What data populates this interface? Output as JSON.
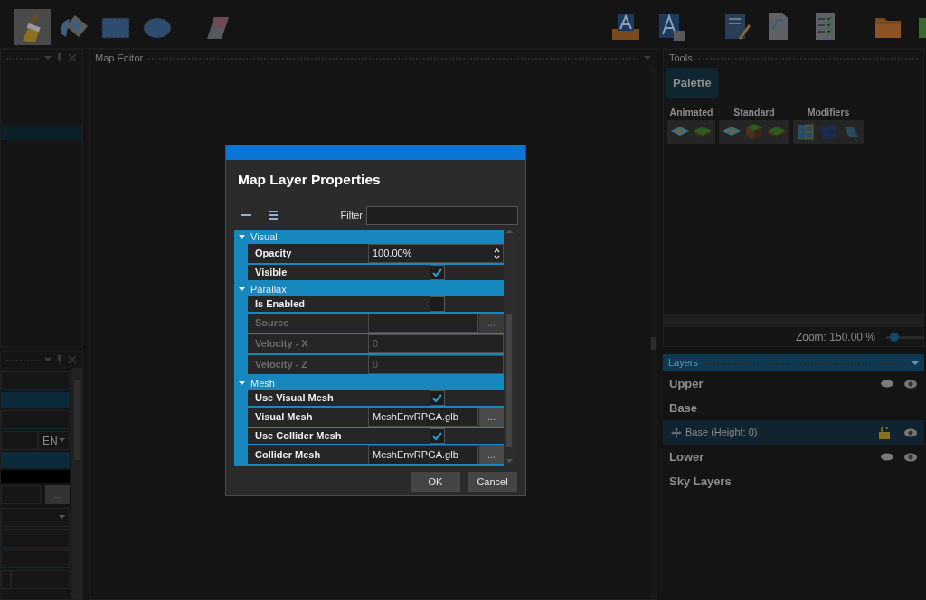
{
  "toolbar": {
    "tools": [
      {
        "kind": "brush",
        "selected": true
      },
      {
        "kind": "fill",
        "selected": false
      },
      {
        "kind": "rect",
        "selected": false
      },
      {
        "kind": "ellipse",
        "selected": false
      },
      {
        "kind": "eraser",
        "selected": false
      }
    ],
    "actions": [
      {
        "kind": "open"
      },
      {
        "kind": "save"
      },
      {
        "kind": "notes"
      },
      {
        "kind": "formula"
      },
      {
        "kind": "checklist"
      },
      {
        "kind": "folder"
      },
      {
        "kind": "run"
      }
    ]
  },
  "left_panel": {
    "rows": [
      {
        "kind": "field"
      },
      {
        "kind": "band"
      },
      {
        "kind": "field"
      },
      {
        "kind": "lang",
        "value": "EN"
      },
      {
        "kind": "band"
      },
      {
        "kind": "black"
      },
      {
        "kind": "browse",
        "button": "..."
      },
      {
        "kind": "select"
      },
      {
        "kind": "field"
      },
      {
        "kind": "field"
      },
      {
        "kind": "split"
      }
    ]
  },
  "map_editor": {
    "title": "Map Editor"
  },
  "tools_panel": {
    "title": "Tools",
    "tab": "Palette",
    "groups": [
      {
        "label": "Animated",
        "tiles": [
          {
            "kind": "water"
          },
          {
            "kind": "grass"
          }
        ]
      },
      {
        "label": "Standard",
        "tiles": [
          {
            "kind": "water"
          },
          {
            "kind": "block"
          },
          {
            "kind": "grass"
          }
        ]
      },
      {
        "label": "Modifiers",
        "tiles": [
          {
            "kind": "numbers"
          },
          {
            "kind": "numbers-dark"
          },
          {
            "kind": "ramp"
          }
        ]
      }
    ],
    "zoom": {
      "label": "Zoom: 150.00 %",
      "level": 0.1
    }
  },
  "layers": {
    "title": "Layers",
    "items": [
      {
        "label": "Upper",
        "kind": "group"
      },
      {
        "label": "Base",
        "kind": "header",
        "children": [
          {
            "label": "Base (Height: 0)",
            "kind": "layer",
            "selected": true
          }
        ]
      },
      {
        "label": "Lower",
        "kind": "group"
      },
      {
        "label": "Sky Layers",
        "kind": "header"
      }
    ]
  },
  "dialog": {
    "title": "Map Layer Properties",
    "filter_label": "Filter",
    "categories": [
      {
        "label": "Visual",
        "expanded": true,
        "properties": [
          {
            "label": "Opacity",
            "kind": "spin",
            "value": "100.00%",
            "disabled": false
          },
          {
            "label": "Visible",
            "kind": "check",
            "checked": true,
            "disabled": false
          }
        ]
      },
      {
        "label": "Parallax",
        "expanded": true,
        "properties": [
          {
            "label": "Is Enabled",
            "kind": "check",
            "checked": false,
            "disabled": false
          },
          {
            "label": "Source",
            "kind": "file",
            "button": "...",
            "disabled": true
          },
          {
            "label": "Velocity - X",
            "kind": "text",
            "value": "0",
            "disabled": true
          },
          {
            "label": "Velocity - Z",
            "kind": "text",
            "value": "0",
            "disabled": true
          }
        ]
      },
      {
        "label": "Mesh",
        "expanded": true,
        "properties": [
          {
            "label": "Use Visual Mesh",
            "kind": "check",
            "checked": true,
            "disabled": false
          },
          {
            "label": "Visual Mesh",
            "kind": "file",
            "value": "MeshEnvRPGA.glb",
            "button": "...",
            "disabled": false
          },
          {
            "label": "Use Collider Mesh",
            "kind": "check",
            "checked": true,
            "disabled": false
          },
          {
            "label": "Collider Mesh",
            "kind": "file",
            "value": "MeshEnvRPGA.glb",
            "button": "...",
            "disabled": false
          }
        ]
      }
    ],
    "buttons": [
      "OK",
      "Cancel"
    ]
  }
}
